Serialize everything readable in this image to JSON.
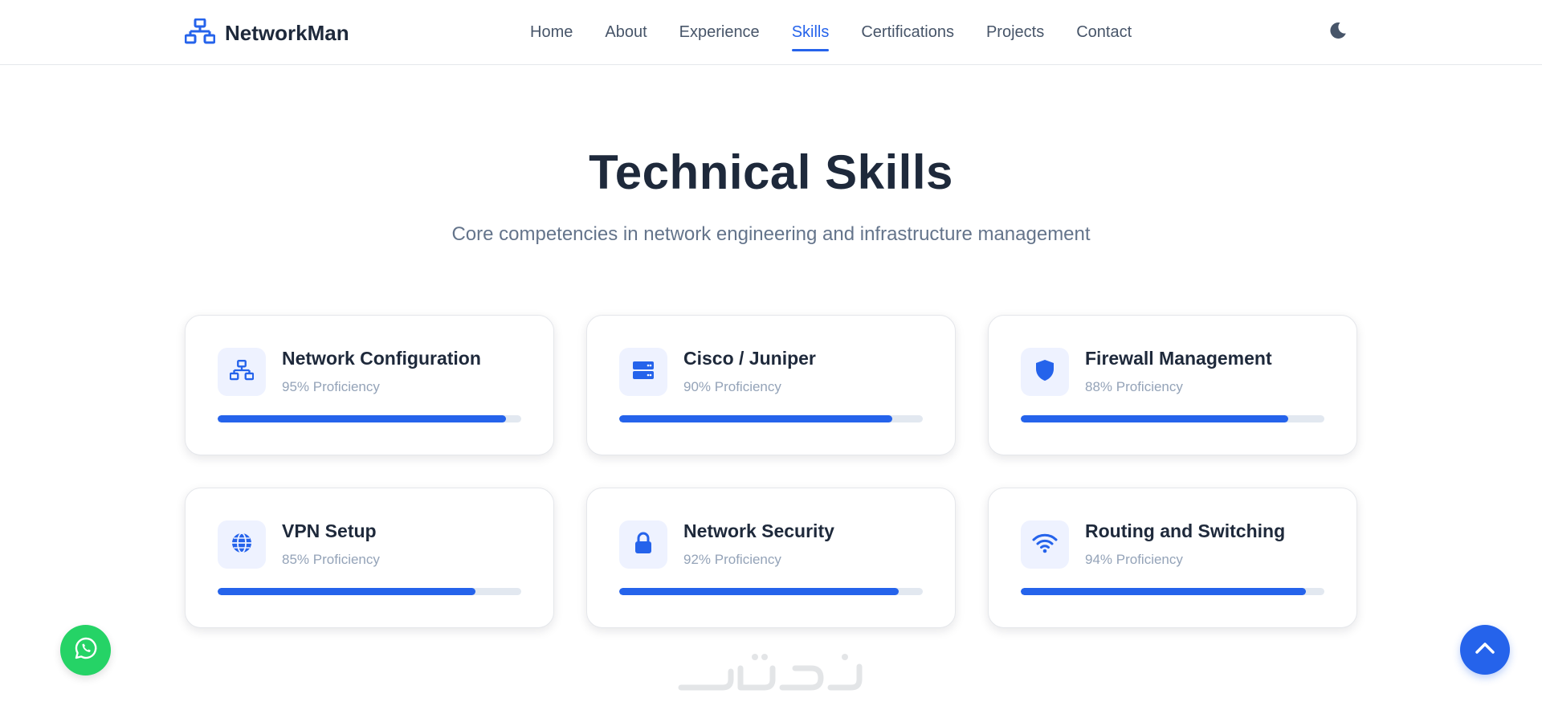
{
  "header": {
    "brand": "NetworkMan",
    "brand_icon": "network-icon",
    "nav": [
      {
        "label": "Home",
        "active": false
      },
      {
        "label": "About",
        "active": false
      },
      {
        "label": "Experience",
        "active": false
      },
      {
        "label": "Skills",
        "active": true
      },
      {
        "label": "Certifications",
        "active": false
      },
      {
        "label": "Projects",
        "active": false
      },
      {
        "label": "Contact",
        "active": false
      }
    ],
    "theme_toggle_icon": "moon-icon"
  },
  "section": {
    "title": "Technical Skills",
    "subtitle": "Core competencies in network engineering and infrastructure management"
  },
  "skills": [
    {
      "name": "Network Configuration",
      "proficiency_text": "95% Proficiency",
      "percent": 95,
      "icon": "network-icon"
    },
    {
      "name": "Cisco / Juniper",
      "proficiency_text": "90% Proficiency",
      "percent": 90,
      "icon": "server-icon"
    },
    {
      "name": "Firewall Management",
      "proficiency_text": "88% Proficiency",
      "percent": 88,
      "icon": "shield-icon"
    },
    {
      "name": "VPN Setup",
      "proficiency_text": "85% Proficiency",
      "percent": 85,
      "icon": "globe-icon"
    },
    {
      "name": "Network Security",
      "proficiency_text": "92% Proficiency",
      "percent": 92,
      "icon": "lock-icon"
    },
    {
      "name": "Routing and Switching",
      "proficiency_text": "94% Proficiency",
      "percent": 94,
      "icon": "wifi-icon"
    }
  ],
  "floating": {
    "whatsapp_icon": "whatsapp-icon",
    "back_to_top_icon": "chevron-up-icon"
  },
  "colors": {
    "accent": "#2563eb",
    "whatsapp": "#25d366",
    "icon_bg": "#eef2ff",
    "track": "#e2e8f0"
  }
}
